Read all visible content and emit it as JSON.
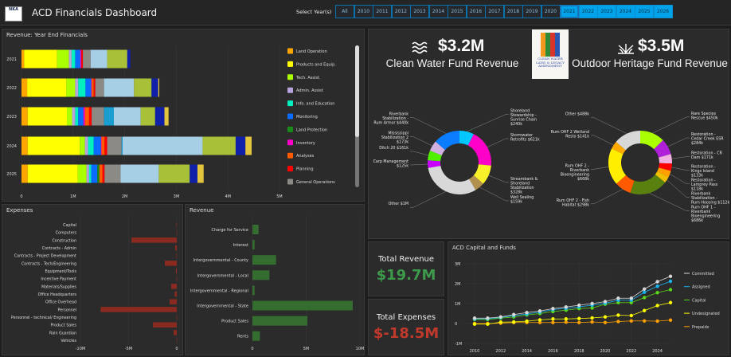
{
  "header": {
    "title": "ACD Financials Dashboard",
    "logo_text": "NKA",
    "year_select_label": "Select Year(s)",
    "years": [
      {
        "label": "All",
        "selected": false
      },
      {
        "label": "2010",
        "selected": false
      },
      {
        "label": "2011",
        "selected": false
      },
      {
        "label": "2012",
        "selected": false
      },
      {
        "label": "2013",
        "selected": false
      },
      {
        "label": "2014",
        "selected": false
      },
      {
        "label": "2015",
        "selected": false
      },
      {
        "label": "2016",
        "selected": false
      },
      {
        "label": "2017",
        "selected": false
      },
      {
        "label": "2018",
        "selected": false
      },
      {
        "label": "2019",
        "selected": false
      },
      {
        "label": "2020",
        "selected": false
      },
      {
        "label": "2021",
        "selected": true
      },
      {
        "label": "2022",
        "selected": true
      },
      {
        "label": "2023",
        "selected": true
      },
      {
        "label": "2024",
        "selected": true
      },
      {
        "label": "2025",
        "selected": true
      },
      {
        "label": "2026",
        "selected": true
      }
    ]
  },
  "kpis": {
    "clean_water": {
      "value": "$3.2M",
      "label": "Clean Water Fund Revenue",
      "icon": "water-waves-icon"
    },
    "outdoor_heritage": {
      "value": "$3.5M",
      "label": "Outdoor Heritage Fund Revenue",
      "icon": "grass-plant-icon"
    },
    "logo_text": "CLEAN WATER LAND & LEGACY AMENDMENT"
  },
  "totals": {
    "revenue_label": "Total Revenue",
    "revenue_value": "$19.7M",
    "revenue_color": "#3e9a4b",
    "expenses_label": "Total Expenses",
    "expenses_value": "$-18.5M",
    "expenses_color": "#c0392b"
  },
  "chart_data": [
    {
      "id": "year_end",
      "type": "bar",
      "orientation": "horizontal",
      "stacked": true,
      "title": "Revenue: Year End Financials",
      "categories": [
        "2021",
        "2022",
        "2023",
        "2024",
        "2025"
      ],
      "xlim": [
        0,
        5
      ],
      "x_ticks": [
        "0",
        "1M",
        "2M",
        "3M",
        "4M",
        "5M"
      ],
      "legend": "right (scrollable)",
      "series": [
        {
          "name": "Land Operation",
          "color": "#ffa500",
          "values": [
            0.05,
            0.11,
            0.12,
            0.12,
            0.12
          ]
        },
        {
          "name": "Products and Equip.",
          "color": "#ffff00",
          "values": [
            0.64,
            0.76,
            0.76,
            1.01,
            0.97
          ]
        },
        {
          "name": "Tech. Assist.",
          "color": "#aaff00",
          "values": [
            0.23,
            0.17,
            0.1,
            0.1,
            0.17
          ]
        },
        {
          "name": "Admin. Assist",
          "color": "#b9a3dc",
          "values": [
            0.05,
            0.06,
            0.06,
            0.06,
            0.05
          ]
        },
        {
          "name": "Info. and Education",
          "color": "#00f0c0",
          "values": [
            0.07,
            0.14,
            0.06,
            0.11,
            0.04
          ]
        },
        {
          "name": "Monitoring",
          "color": "#0a6cff",
          "values": [
            0.1,
            0.11,
            0.1,
            0.14,
            0.12
          ]
        },
        {
          "name": "Land Protection",
          "color": "#1a8a1a",
          "values": [
            0,
            0,
            0,
            0,
            0.04
          ]
        },
        {
          "name": "Inventory",
          "color": "#ff00c8",
          "values": [
            0.02,
            0.01,
            0.03,
            0.01,
            0
          ]
        },
        {
          "name": "Analyses",
          "color": "#ff5a00",
          "values": [
            0,
            0.04,
            0.08,
            0.06,
            0.06
          ]
        },
        {
          "name": "Planning",
          "color": "#ff0000",
          "values": [
            0.03,
            0.03,
            0.05,
            0.05,
            0.04
          ]
        },
        {
          "name": "General Operations",
          "color": "#8c8a84",
          "values": [
            0.15,
            0.17,
            0.24,
            0.28,
            0.31
          ]
        },
        {
          "color": "#1a9ed0",
          "values": [
            0,
            0,
            0.19,
            0.02,
            0
          ]
        },
        {
          "color": "#a6cfe6",
          "values": [
            0.32,
            0.58,
            0.52,
            1.55,
            0.74
          ]
        },
        {
          "color": "#a8c038",
          "values": [
            0.39,
            0.34,
            0.28,
            0.64,
            0.6
          ]
        },
        {
          "color": "#1020a8",
          "values": [
            0.06,
            0.13,
            0.18,
            0.19,
            0.15
          ]
        },
        {
          "color": "#e2c53c",
          "values": [
            0,
            0.02,
            0.08,
            0.12,
            0.12
          ]
        }
      ]
    },
    {
      "id": "expenses",
      "type": "bar",
      "orientation": "horizontal",
      "title": "Expenses",
      "xlim": [
        -10,
        0
      ],
      "x_ticks": [
        "-10M",
        "-5M",
        "0"
      ],
      "color": "#8b2a20",
      "categories": [
        "Capital",
        "Computers",
        "Construction",
        "Contracts - Admin",
        "Contracts - Project Development",
        "Contracts - Tech/Engineering",
        "Equipment/Tools",
        "Incentive Payment",
        "Materials/Supplies",
        "Office Headquarters",
        "Office Overhead",
        "Personnel",
        "Personnel - technical/ Engineering",
        "Product Sales",
        "Rain Guardian",
        "Vehicles"
      ],
      "values": [
        -0.05,
        -0.02,
        -4.7,
        -0.17,
        -0.05,
        -1.24,
        -0.1,
        -0.02,
        -0.58,
        -0.22,
        -0.74,
        -7.9,
        -0.02,
        -2.47,
        -0.33,
        -0.02
      ]
    },
    {
      "id": "revenue",
      "type": "bar",
      "orientation": "horizontal",
      "title": "Revenue",
      "xlim": [
        0,
        10
      ],
      "x_ticks": [
        "0",
        "5M",
        "10M"
      ],
      "color": "#356d30",
      "categories": [
        "Charge for Service",
        "Interest",
        "Intergovernmental - County",
        "Intergovernmental - Local",
        "Intergovernmental - Regional",
        "Intergovernmental - State",
        "Product Sales",
        "Rents"
      ],
      "values": [
        0.57,
        0.2,
        2.2,
        1.58,
        0.2,
        9.33,
        5.12,
        0.69
      ]
    },
    {
      "id": "clean_water_donut",
      "type": "pie",
      "donut": true,
      "slices": [
        {
          "label": "Shoreland Stewardship - Sunrise Chain $240k",
          "value": 240,
          "color": "#00c8ff"
        },
        {
          "label": "Stormwater Retrofits $621k",
          "value": 621,
          "color": "#ff00c8"
        },
        {
          "label": "Streambank & Shoreland Stabilization $328k",
          "value": 328,
          "color": "#f8f028"
        },
        {
          "label": "Well Sealing $159k",
          "value": 159,
          "color": "#b0904c"
        },
        {
          "label": "Other $1M",
          "value": 1000,
          "color": "#d8d8d8"
        },
        {
          "label": "Carp Management $125k",
          "value": 125,
          "color": "#c800ff"
        },
        {
          "label": "Ditch 20 $161k",
          "value": 161,
          "color": "#50f000"
        },
        {
          "label": "Mississippi Stabilization 2 $173k",
          "value": 173,
          "color": "#d0b0e0"
        },
        {
          "label": "Riverbank Stabilization - Rum Armor $440k",
          "value": 440,
          "color": "#0a7cff"
        }
      ]
    },
    {
      "id": "ohf_donut",
      "type": "pie",
      "donut": true,
      "slices": [
        {
          "label": "Rare Species Rescue $450k",
          "value": 450,
          "color": "#aaff00"
        },
        {
          "label": "Restoration - Cedar Creek ESR $284k",
          "value": 284,
          "color": "#b020d8"
        },
        {
          "label": "Restoration - CR Dam $171k",
          "value": 171,
          "color": "#f0b0e0"
        },
        {
          "label": "Restoration - Kings Island $133k",
          "value": 133,
          "color": "#ff0000"
        },
        {
          "label": "Restoration - Lamprey Pass $118k",
          "value": 118,
          "color": "#ffa000"
        },
        {
          "label": "Riverbank Stabilization - Rum Hoosing $112k",
          "value": 112,
          "color": "#f0c000"
        },
        {
          "label": "Rum OHF 1 - Riverbank Bioengineering $686k",
          "value": 686,
          "color": "#5a8010"
        },
        {
          "label": "Rum OHF 2 - Fish Habitat $298k",
          "value": 298,
          "color": "#ff5a00"
        },
        {
          "label": "Rum OHF 2 - Riverbank Bioengineering $668k",
          "value": 668,
          "color": "#ffee00"
        },
        {
          "label": "Rum OHF 2 Wetland Resto $141k",
          "value": 141,
          "color": "#ffa800"
        },
        {
          "label": "Other $488k",
          "value": 488,
          "color": "#d8d8d8"
        }
      ]
    },
    {
      "id": "capital_funds",
      "type": "line",
      "title": "ACD Capital and Funds",
      "x": [
        2010,
        2011,
        2012,
        2013,
        2014,
        2015,
        2016,
        2017,
        2018,
        2019,
        2020,
        2021,
        2022,
        2023,
        2024,
        2025
      ],
      "x_ticks": [
        "2010",
        "2012",
        "2014",
        "2016",
        "2018",
        "2020",
        "2022",
        "2024"
      ],
      "ylim": [
        -1,
        3
      ],
      "y_ticks": [
        "3M",
        "2M",
        "1M",
        "0",
        "-1M"
      ],
      "legend": "right",
      "series": [
        {
          "name": "Committed",
          "color": "#d8d8d8",
          "values": [
            0.27,
            0.27,
            0.33,
            0.45,
            0.55,
            0.63,
            0.75,
            0.83,
            0.92,
            1.0,
            1.1,
            1.27,
            1.27,
            1.73,
            2.1,
            2.37
          ]
        },
        {
          "name": "Assigned",
          "color": "#18b4f0",
          "values": [
            0.23,
            0.24,
            0.3,
            0.4,
            0.48,
            0.57,
            0.7,
            0.76,
            0.84,
            0.92,
            1.02,
            1.17,
            1.17,
            1.57,
            1.87,
            2.12
          ]
        },
        {
          "name": "Capital",
          "color": "#58d818",
          "values": [
            0.2,
            0.2,
            0.27,
            0.33,
            0.43,
            0.5,
            0.6,
            0.67,
            0.75,
            0.78,
            0.97,
            1.05,
            1.05,
            1.3,
            1.55,
            1.7
          ]
        },
        {
          "name": "Undesignated",
          "color": "#ffff00",
          "values": [
            -0.03,
            -0.03,
            0.07,
            0.08,
            0.12,
            0.18,
            0.23,
            0.23,
            0.25,
            0.28,
            0.33,
            0.42,
            0.4,
            0.65,
            0.9,
            1.05
          ]
        },
        {
          "name": "Prepaids",
          "color": "#ffa000",
          "values": [
            0,
            0,
            0.02,
            0.05,
            0.05,
            0.05,
            0.05,
            0.07,
            0.05,
            0.08,
            0.05,
            0.1,
            0.13,
            0.13,
            0.12,
            0.17
          ]
        }
      ]
    }
  ]
}
